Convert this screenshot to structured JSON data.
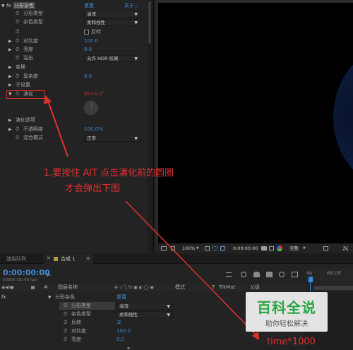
{
  "effect_controls": {
    "fx_label": "fx",
    "effect_name": "分形杂色",
    "reset_label": "重置",
    "about_label": "关于...",
    "props": {
      "fractal_type": {
        "label": "分形类型",
        "value": "湍流"
      },
      "noise_type": {
        "label": "杂色类型",
        "value": "柔和线性"
      },
      "invert": {
        "label": "反转"
      },
      "contrast": {
        "label": "对比度",
        "value": "100.0"
      },
      "brightness": {
        "label": "亮度",
        "value": "0.0"
      },
      "overflow": {
        "label": "溢出",
        "value": "允许 HDR 结果"
      },
      "transform": {
        "label": "变换"
      },
      "complexity": {
        "label": "复杂度",
        "value": "6.0"
      },
      "sub_settings": {
        "label": "子设置"
      },
      "evolution": {
        "label": "演化",
        "value": "0x+0.0°"
      },
      "evolution_options": {
        "label": "演化选项"
      },
      "opacity": {
        "label": "不透明度",
        "value": "100.0%"
      },
      "blend_mode": {
        "label": "混合模式",
        "value": "正常"
      }
    }
  },
  "viewer": {
    "zoom": "100%",
    "timecode": "0:00:00:00",
    "quality": "完整"
  },
  "annotation": {
    "line1": "1.要按住 AlT 点击演化前的圆圈",
    "line2": "才会弹出下图",
    "bottom_text": "time*1000",
    "color": "#e0322e"
  },
  "timeline": {
    "tab_render_queue": "渲染队列",
    "tab_comp": "合成 1",
    "timecode": "0:00:00:00",
    "fps": "00000 (30.00 fps)",
    "search_placeholder": "ρ.",
    "ruler_start": "0s",
    "ruler_mark": "00:15f",
    "columns": {
      "hash": "#",
      "layer_name": "图层名称",
      "mode": "模式",
      "t": "T",
      "trkmat": "TrkMat",
      "parent": "父级"
    },
    "rows": {
      "effect_name": "分形杂色",
      "reset": "重置",
      "fractal_type": {
        "label": "分形类型",
        "value": "湍流"
      },
      "noise_type": {
        "label": "杂色类型",
        "value": "柔和线性"
      },
      "invert": {
        "label": "反转",
        "value": "关"
      },
      "contrast": {
        "label": "对比度",
        "value": "100.0"
      },
      "brightness": {
        "label": "亮度",
        "value": "0.0"
      }
    }
  },
  "watermark": {
    "title": "百科全说",
    "subtitle": "助你轻松解决"
  }
}
